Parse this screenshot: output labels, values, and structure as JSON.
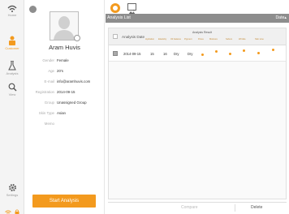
{
  "sidebar": {
    "items": [
      {
        "label": "Home",
        "icon": "wifi-icon"
      },
      {
        "label": "Customer",
        "icon": "customer-icon"
      },
      {
        "label": "Analysis",
        "icon": "flask-icon"
      },
      {
        "label": "View",
        "icon": "search-icon"
      }
    ],
    "settings_label": "Settings",
    "status_icons": [
      "wifi-status-icon",
      "lock-icon"
    ]
  },
  "profile": {
    "name": "Aram Huvis",
    "fields": [
      {
        "label": "Gender",
        "value": "Female"
      },
      {
        "label": "Age",
        "value": "20's"
      },
      {
        "label": "E-mail",
        "value": "info@aramhuvis.com"
      },
      {
        "label": "Registration",
        "value": "2014-09-15"
      },
      {
        "label": "Group",
        "value": "Unassigned Group"
      },
      {
        "label": "Skin Type",
        "value": "Asian"
      },
      {
        "label": "Memo",
        "value": ""
      }
    ],
    "start_button": "Start Analysis"
  },
  "analysis": {
    "list_title": "Analysis List",
    "sort_label": "Date▴",
    "columns": {
      "date": "Analysis Date",
      "result": "Analysis Result",
      "subs": [
        "Hydration",
        "Elasticity",
        "Oil balance",
        "Pigment",
        "Pores",
        "Moisture",
        "Sebum",
        "Wrinkle",
        "Skin tone"
      ]
    },
    "rows": [
      {
        "date": "2014-09-15",
        "values": [
          "15",
          "16",
          "Dry",
          "Dry"
        ]
      }
    ]
  },
  "footer": {
    "compare": "Compare",
    "delete": "Delete"
  },
  "colors": {
    "accent": "#f39a1e",
    "header_gray": "#8d8d8d"
  }
}
